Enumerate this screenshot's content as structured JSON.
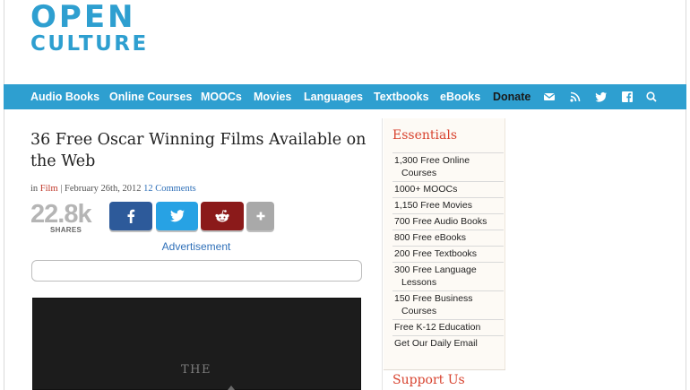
{
  "logo": {
    "line1": "OPEN",
    "line2": "CULTURE"
  },
  "nav": {
    "items": [
      "Audio Books",
      "Online Courses",
      "MOOCs",
      "Movies",
      "Languages",
      "Textbooks",
      "eBooks",
      "Donate"
    ],
    "icons": [
      "mail-icon",
      "rss-icon",
      "twitter-icon",
      "facebook-icon",
      "search-icon"
    ]
  },
  "article": {
    "title": "36 Free Oscar Winning Films Available on the Web",
    "meta": {
      "prefix": "in",
      "category": "Film",
      "separator": "|",
      "date": "February 26th, 2012",
      "comments": "12 Comments"
    }
  },
  "share": {
    "count": "22.8k",
    "label": "SHARES",
    "buttons": [
      "facebook-icon",
      "twitter-icon",
      "reddit-icon",
      "plus-icon"
    ]
  },
  "ad": {
    "label": "Advertisement"
  },
  "video": {
    "text": "THE"
  },
  "sidebar": {
    "heading": "Essentials",
    "items": [
      {
        "line1": "1,300 Free Online",
        "line2": "Courses"
      },
      {
        "line1": "1000+ MOOCs",
        "line2": ""
      },
      {
        "line1": "1,150 Free Movies",
        "line2": ""
      },
      {
        "line1": "700 Free Audio Books",
        "line2": ""
      },
      {
        "line1": "800 Free eBooks",
        "line2": ""
      },
      {
        "line1": "200 Free Textbooks",
        "line2": ""
      },
      {
        "line1": "300 Free Language",
        "line2": "Lessons"
      },
      {
        "line1": "150 Free Business",
        "line2": "Courses"
      },
      {
        "line1": "Free K-12 Education",
        "line2": ""
      },
      {
        "line1": "Get Our Daily Email",
        "line2": ""
      }
    ],
    "support_heading": "Support Us"
  },
  "colors": {
    "brand": "#2e9fd0",
    "accent_red": "#d8432f",
    "facebook": "#2d5a9a",
    "twitter": "#27a2e4",
    "reddit": "#8b1a1a",
    "more": "#a9a9a9"
  }
}
